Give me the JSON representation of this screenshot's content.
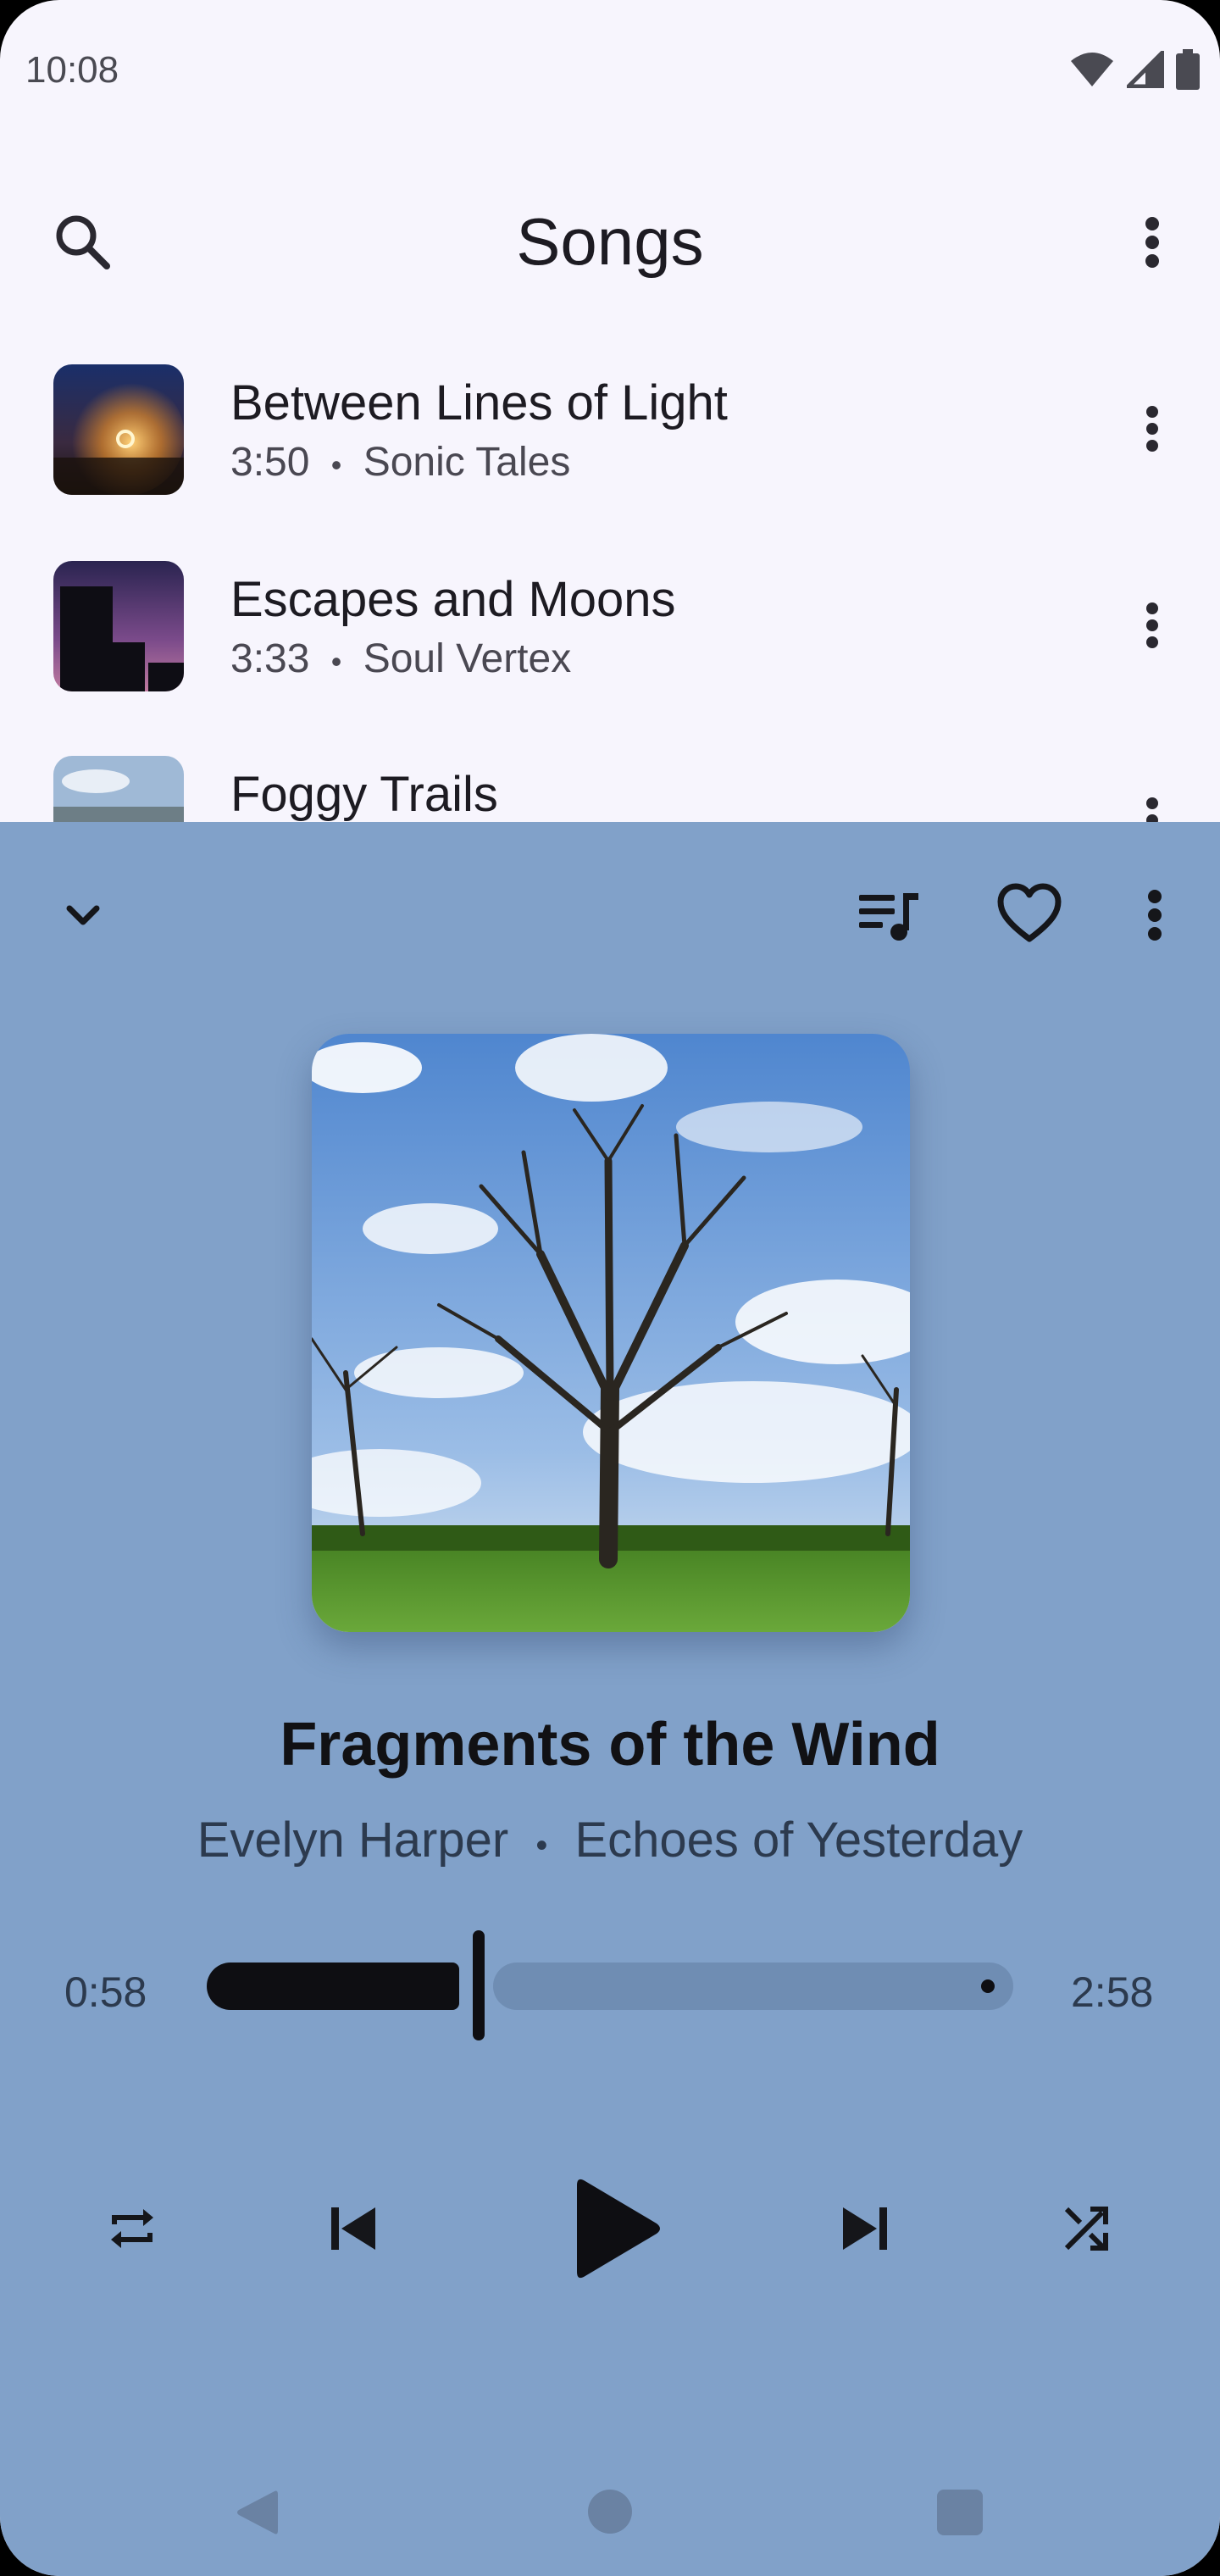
{
  "status_bar": {
    "time": "10:08"
  },
  "top_bar": {
    "title": "Songs"
  },
  "songs": [
    {
      "title": "Between Lines of Light",
      "duration": "3:50",
      "separator": "•",
      "artist": "Sonic Tales"
    },
    {
      "title": "Escapes and Moons",
      "duration": "3:33",
      "separator": "•",
      "artist": "Soul Vertex"
    },
    {
      "title": "Foggy Trails",
      "duration": "",
      "separator": "",
      "artist": ""
    }
  ],
  "player": {
    "title": "Fragments of the Wind",
    "artist": "Evelyn Harper",
    "separator": "•",
    "album": "Echoes of Yesterday",
    "elapsed": "0:58",
    "total": "2:58",
    "progress": 0.33,
    "favorited": false
  },
  "colors": {
    "player_background": "#81a1c9",
    "list_background": "#f7f5fd",
    "accent_dark": "#0e0e12"
  },
  "icons": {
    "search": "search-icon",
    "more": "more-vert-icon",
    "collapse": "chevron-down-icon",
    "queue": "queue-music-icon",
    "favorite": "heart-outline-icon",
    "repeat": "repeat-icon",
    "previous": "skip-previous-icon",
    "play": "play-icon",
    "next": "skip-next-icon",
    "shuffle": "shuffle-icon"
  }
}
